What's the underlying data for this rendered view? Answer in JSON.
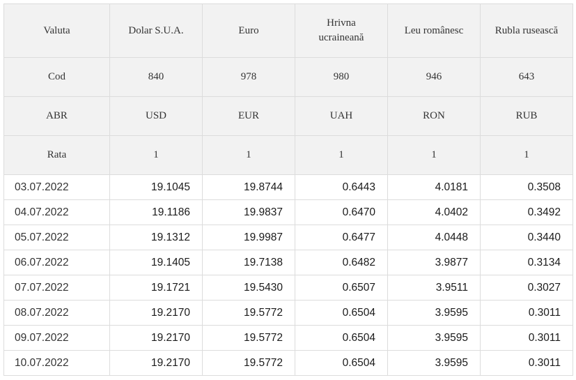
{
  "header": {
    "valuta_label": "Valuta",
    "currencies": [
      "Dolar S.U.A.",
      "Euro",
      "Hrivna ucraineană",
      "Leu românesc",
      "Rubla rusească"
    ],
    "cod_label": "Cod",
    "codes": [
      "840",
      "978",
      "980",
      "946",
      "643"
    ],
    "abr_label": "ABR",
    "abbreviations": [
      "USD",
      "EUR",
      "UAH",
      "RON",
      "RUB"
    ],
    "rata_label": "Rata",
    "rates": [
      "1",
      "1",
      "1",
      "1",
      "1"
    ]
  },
  "rows": [
    {
      "date": "03.07.2022",
      "values": [
        "19.1045",
        "19.8744",
        "0.6443",
        "4.0181",
        "0.3508"
      ]
    },
    {
      "date": "04.07.2022",
      "values": [
        "19.1186",
        "19.9837",
        "0.6470",
        "4.0402",
        "0.3492"
      ]
    },
    {
      "date": "05.07.2022",
      "values": [
        "19.1312",
        "19.9987",
        "0.6477",
        "4.0448",
        "0.3440"
      ]
    },
    {
      "date": "06.07.2022",
      "values": [
        "19.1405",
        "19.7138",
        "0.6482",
        "3.9877",
        "0.3134"
      ]
    },
    {
      "date": "07.07.2022",
      "values": [
        "19.1721",
        "19.5430",
        "0.6507",
        "3.9511",
        "0.3027"
      ]
    },
    {
      "date": "08.07.2022",
      "values": [
        "19.2170",
        "19.5772",
        "0.6504",
        "3.9595",
        "0.3011"
      ]
    },
    {
      "date": "09.07.2022",
      "values": [
        "19.2170",
        "19.5772",
        "0.6504",
        "3.9595",
        "0.3011"
      ]
    },
    {
      "date": "10.07.2022",
      "values": [
        "19.2170",
        "19.5772",
        "0.6504",
        "3.9595",
        "0.3011"
      ]
    }
  ],
  "colors": {
    "header_bg": "#f2f2f2",
    "border": "#dcdcdc",
    "row_bg": "#ffffff"
  }
}
